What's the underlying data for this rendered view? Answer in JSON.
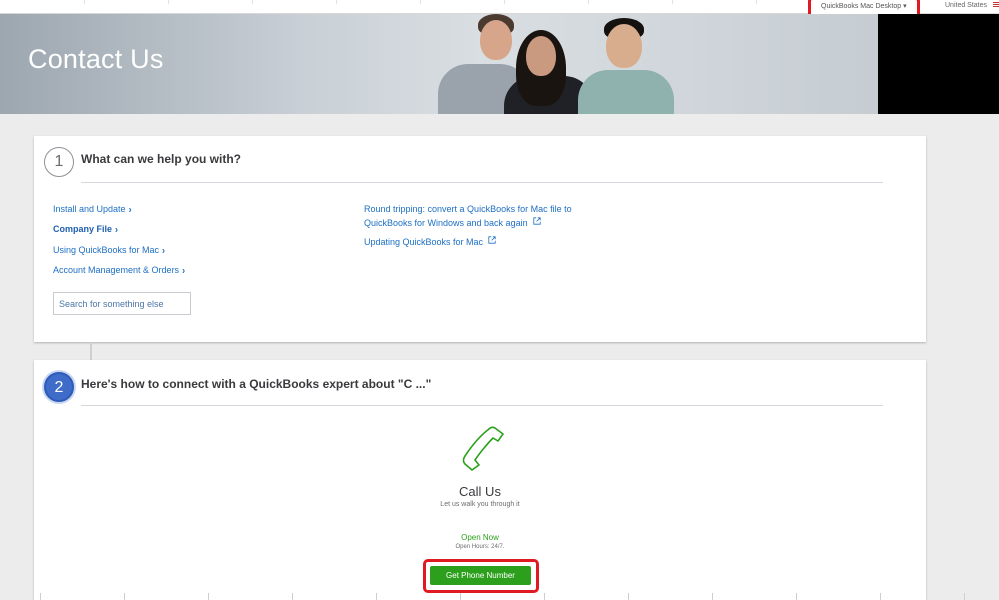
{
  "topbar": {
    "product_selector": "QuickBooks Mac Desktop ▾",
    "region": "United States"
  },
  "hero": {
    "title": "Contact Us"
  },
  "step1": {
    "number": "1",
    "title": "What can we help you with?",
    "topics": [
      {
        "label": "Install and Update",
        "active": false
      },
      {
        "label": "Company File",
        "active": true
      },
      {
        "label": "Using QuickBooks for Mac",
        "active": false
      },
      {
        "label": "Account Management & Orders",
        "active": false
      }
    ],
    "search_placeholder": "Search for something else",
    "articles": [
      {
        "line1": "Round tripping: convert a QuickBooks for Mac file to",
        "line2": "QuickBooks for Windows and back again"
      },
      {
        "line1": "Updating QuickBooks for Mac",
        "line2": ""
      }
    ]
  },
  "step2": {
    "number": "2",
    "title": "Here's how to connect with a QuickBooks expert about \"C ...\"",
    "call_title": "Call Us",
    "call_subtitle": "Let us walk you through it",
    "status": "Open Now",
    "hours": "Open Hours: 24/7.",
    "button_label": "Get Phone Number"
  },
  "colors": {
    "link": "#1e6fc4",
    "accent_green": "#2ca01c",
    "highlight_red": "#e01a22",
    "step_blue": "#3f6bc9"
  }
}
